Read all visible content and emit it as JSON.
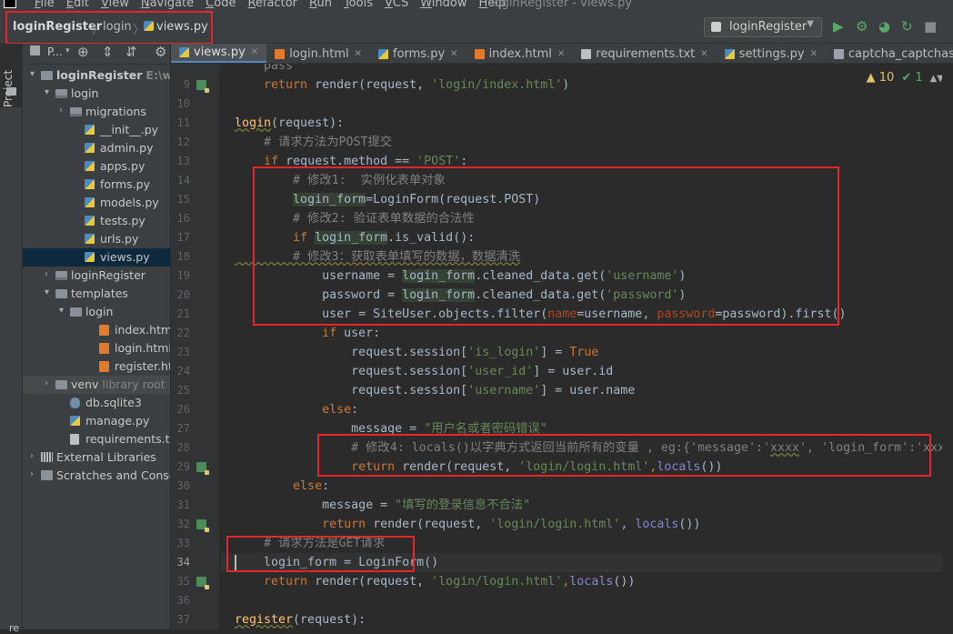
{
  "menu": {
    "items": [
      "File",
      "Edit",
      "View",
      "Navigate",
      "Code",
      "Refactor",
      "Run",
      "Tools",
      "VCS",
      "Window",
      "Help"
    ],
    "window_title": "loginRegister - views.py"
  },
  "navbar": {
    "project": "loginRegister",
    "folder": "login",
    "file": "views.py",
    "separator": "〉"
  },
  "run": {
    "config": "loginRegister",
    "run_icon": "▶",
    "debug_icon": "⚙",
    "coverage_icon": "◕",
    "profile_icon": "↻",
    "stop_icon": "■"
  },
  "toolstrip": {
    "project_label": "Project",
    "bottom_label": "re"
  },
  "project_panel": {
    "label": "P...",
    "caret": "▾"
  },
  "tree": [
    {
      "label": "loginRegister",
      "suffix": "E:\\wo",
      "icon": "folder",
      "arrow": "▾",
      "level": 0,
      "bold": true
    },
    {
      "label": "login",
      "suffix": "",
      "icon": "pkg",
      "arrow": "▾",
      "level": 1
    },
    {
      "label": "migrations",
      "suffix": "",
      "icon": "pkg",
      "arrow": "›",
      "level": 2
    },
    {
      "label": "__init__.py",
      "suffix": "",
      "icon": "py",
      "arrow": "",
      "level": 3
    },
    {
      "label": "admin.py",
      "suffix": "",
      "icon": "py",
      "arrow": "",
      "level": 3
    },
    {
      "label": "apps.py",
      "suffix": "",
      "icon": "py",
      "arrow": "",
      "level": 3
    },
    {
      "label": "forms.py",
      "suffix": "",
      "icon": "py",
      "arrow": "",
      "level": 3
    },
    {
      "label": "models.py",
      "suffix": "",
      "icon": "py",
      "arrow": "",
      "level": 3
    },
    {
      "label": "tests.py",
      "suffix": "",
      "icon": "py",
      "arrow": "",
      "level": 3
    },
    {
      "label": "urls.py",
      "suffix": "",
      "icon": "py",
      "arrow": "",
      "level": 3
    },
    {
      "label": "views.py",
      "suffix": "",
      "icon": "py",
      "arrow": "",
      "level": 3,
      "selected": true
    },
    {
      "label": "loginRegister",
      "suffix": "",
      "icon": "pkg",
      "arrow": "›",
      "level": 1
    },
    {
      "label": "templates",
      "suffix": "",
      "icon": "folder",
      "arrow": "▾",
      "level": 1
    },
    {
      "label": "login",
      "suffix": "",
      "icon": "folder",
      "arrow": "▾",
      "level": 2
    },
    {
      "label": "index.html",
      "suffix": "",
      "icon": "html",
      "arrow": "",
      "level": 4
    },
    {
      "label": "login.html",
      "suffix": "",
      "icon": "html",
      "arrow": "",
      "level": 4
    },
    {
      "label": "register.htm",
      "suffix": "",
      "icon": "html",
      "arrow": "",
      "level": 4
    },
    {
      "label": "venv",
      "suffix": "library root",
      "icon": "folder",
      "arrow": "›",
      "level": 1,
      "venv": true
    },
    {
      "label": "db.sqlite3",
      "suffix": "",
      "icon": "db",
      "arrow": "",
      "level": 2
    },
    {
      "label": "manage.py",
      "suffix": "",
      "icon": "py",
      "arrow": "",
      "level": 2
    },
    {
      "label": "requirements.txt",
      "suffix": "",
      "icon": "txt",
      "arrow": "",
      "level": 2
    },
    {
      "label": "External Libraries",
      "suffix": "",
      "icon": "lib",
      "arrow": "›",
      "level": 0
    },
    {
      "label": "Scratches and Consc",
      "suffix": "",
      "icon": "scratch",
      "arrow": "›",
      "level": 0
    }
  ],
  "tabs": [
    {
      "label": "views.py",
      "icon": "py",
      "active": true
    },
    {
      "label": "login.html",
      "icon": "html"
    },
    {
      "label": "forms.py",
      "icon": "py"
    },
    {
      "label": "index.html",
      "icon": "html"
    },
    {
      "label": "requirements.txt",
      "icon": "txt"
    },
    {
      "label": "settings.py",
      "icon": "py"
    },
    {
      "label": "captcha_captchastore",
      "icon": "table"
    }
  ],
  "inspections": {
    "warnings": "▲ 10",
    "ok": "✔ 1"
  },
  "code_lines": [
    {
      "n": "",
      "t": [
        [
          "cm",
          "    pass"
        ]
      ]
    },
    {
      "n": "9",
      "t": [
        [
          "",
          "    "
        ],
        [
          "kw",
          "return "
        ],
        [
          "",
          "render(request, "
        ],
        [
          "str",
          "'login/index.html'"
        ],
        [
          "",
          ")"
        ]
      ],
      "gicon": true
    },
    {
      "n": "10",
      "t": []
    },
    {
      "n": "11",
      "t": [
        [
          "fnd",
          "login"
        ],
        [
          "",
          "(request):"
        ]
      ],
      "partial": true
    },
    {
      "n": "12",
      "t": [
        [
          "cm",
          "    # 请求方法为POST提交"
        ]
      ]
    },
    {
      "n": "13",
      "t": [
        [
          "",
          "    "
        ],
        [
          "kw",
          "if "
        ],
        [
          "",
          "request.method == "
        ],
        [
          "str",
          "'POST'"
        ],
        [
          "",
          ":"
        ]
      ]
    },
    {
      "n": "14",
      "t": [
        [
          "cm",
          "        # 修改1:  实例化表单对象"
        ]
      ]
    },
    {
      "n": "15",
      "t": [
        [
          "",
          "        "
        ],
        [
          "hl",
          "login_form"
        ],
        [
          "",
          "=LoginForm(request.POST)"
        ]
      ]
    },
    {
      "n": "16",
      "t": [
        [
          "cm",
          "        # 修改2: 验证表单数据的合法性"
        ]
      ]
    },
    {
      "n": "17",
      "t": [
        [
          "",
          "        "
        ],
        [
          "kw",
          "if "
        ],
        [
          "hl",
          "login_form"
        ],
        [
          "",
          ".is_valid():"
        ]
      ]
    },
    {
      "n": "18",
      "t": [
        [
          "cmu",
          "        # 修改3：获取表单填写的数据，数据清洗"
        ]
      ]
    },
    {
      "n": "19",
      "t": [
        [
          "",
          "            username = "
        ],
        [
          "hl",
          "login_form"
        ],
        [
          "",
          ".cleaned_data.get("
        ],
        [
          "str",
          "'username'"
        ],
        [
          "",
          ")"
        ]
      ]
    },
    {
      "n": "20",
      "t": [
        [
          "",
          "            password = "
        ],
        [
          "hl",
          "login_form"
        ],
        [
          "",
          ".cleaned_data.get("
        ],
        [
          "str",
          "'password'"
        ],
        [
          "",
          ")"
        ]
      ]
    },
    {
      "n": "21",
      "t": [
        [
          "",
          "            user = SiteUser.objects.filter("
        ],
        [
          "kwarg",
          "name"
        ],
        [
          "",
          "=username, "
        ],
        [
          "kwarg",
          "password"
        ],
        [
          "",
          "=password).first()"
        ]
      ]
    },
    {
      "n": "22",
      "t": [
        [
          "",
          "            "
        ],
        [
          "kw",
          "if "
        ],
        [
          "",
          "user:"
        ]
      ]
    },
    {
      "n": "23",
      "t": [
        [
          "",
          "                request.session["
        ],
        [
          "str",
          "'is_login'"
        ],
        [
          "",
          "] = "
        ],
        [
          "kw",
          "True"
        ]
      ]
    },
    {
      "n": "24",
      "t": [
        [
          "",
          "                request.session["
        ],
        [
          "str",
          "'user_id'"
        ],
        [
          "",
          "] = user.id"
        ]
      ]
    },
    {
      "n": "25",
      "t": [
        [
          "",
          "                request.session["
        ],
        [
          "str",
          "'username'"
        ],
        [
          "",
          "] = user.name"
        ]
      ]
    },
    {
      "n": "26",
      "t": [
        [
          "",
          "            "
        ],
        [
          "kw",
          "else"
        ],
        [
          "",
          ":"
        ]
      ]
    },
    {
      "n": "27",
      "t": [
        [
          "",
          "                message = "
        ],
        [
          "str",
          "\"用户名或者密码错误\""
        ]
      ]
    },
    {
      "n": "28",
      "t": [
        [
          "cm",
          "                # 修改4: locals()以字典方式返回当前所有的变量 , eg:{'message':'"
        ],
        [
          "cmu",
          "xxxx"
        ],
        [
          "cm",
          "', 'login_form':'xxx'}"
        ]
      ]
    },
    {
      "n": "29",
      "t": [
        [
          "",
          "                "
        ],
        [
          "kw",
          "return "
        ],
        [
          "",
          "render(request, "
        ],
        [
          "str",
          "'login/login.html'"
        ],
        [
          "kw",
          ","
        ],
        [
          "bi",
          "locals"
        ],
        [
          "",
          "())"
        ]
      ],
      "gicon": true
    },
    {
      "n": "30",
      "t": [
        [
          "",
          "        "
        ],
        [
          "kw",
          "else"
        ],
        [
          "",
          ":"
        ]
      ]
    },
    {
      "n": "31",
      "t": [
        [
          "",
          "            message = "
        ],
        [
          "str",
          "\"填写的登录信息不合法\""
        ]
      ]
    },
    {
      "n": "32",
      "t": [
        [
          "",
          "            "
        ],
        [
          "kw",
          "return "
        ],
        [
          "",
          "render(request, "
        ],
        [
          "str",
          "'login/login.html'"
        ],
        [
          "",
          ", "
        ],
        [
          "bi",
          "locals"
        ],
        [
          "",
          "())"
        ]
      ],
      "gicon": true
    },
    {
      "n": "33",
      "t": [
        [
          "cm",
          "    # 请求方法是GET请求"
        ]
      ]
    },
    {
      "n": "34",
      "t": [
        [
          "",
          "    login_form = LoginForm()"
        ]
      ],
      "current": true
    },
    {
      "n": "35",
      "t": [
        [
          "",
          "    "
        ],
        [
          "kw",
          "return "
        ],
        [
          "",
          "render(request, "
        ],
        [
          "str",
          "'login/login.html'"
        ],
        [
          "kw",
          ","
        ],
        [
          "bi",
          "locals"
        ],
        [
          "",
          "())"
        ]
      ],
      "gicon": true
    },
    {
      "n": "36",
      "t": []
    },
    {
      "n": "37",
      "t": [
        [
          "fnd",
          "register"
        ],
        [
          "",
          "(request):"
        ]
      ],
      "partial": true
    }
  ]
}
